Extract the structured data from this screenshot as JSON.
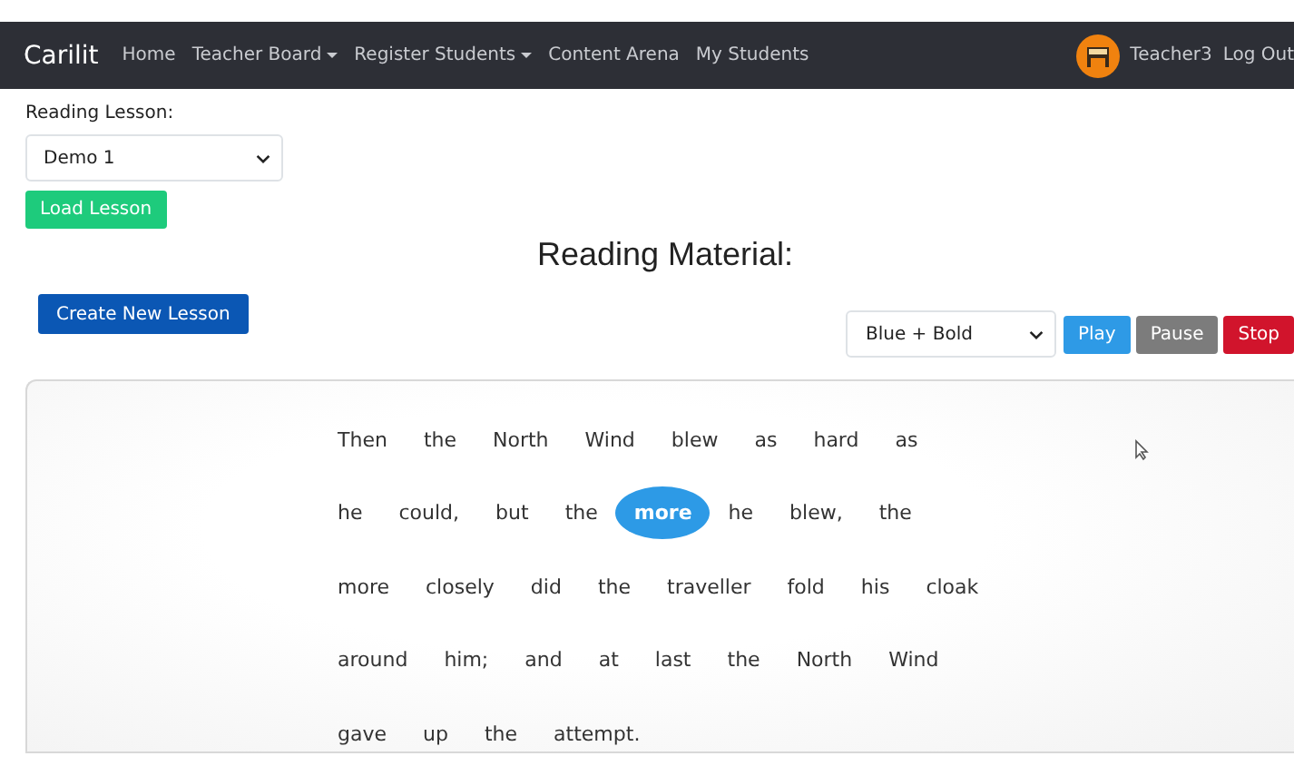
{
  "navbar": {
    "brand": "Carilit",
    "links": [
      {
        "label": "Home",
        "dropdown": false
      },
      {
        "label": "Teacher Board",
        "dropdown": true
      },
      {
        "label": "Register Students",
        "dropdown": true
      },
      {
        "label": "Content Arena",
        "dropdown": false
      },
      {
        "label": "My Students",
        "dropdown": false
      }
    ],
    "user": "Teacher3",
    "logout": "Log Out"
  },
  "lesson_label": "Reading Lesson:",
  "lesson_select": "Demo 1",
  "load_button": "Load Lesson",
  "heading": "Reading Material:",
  "create_button": "Create New Lesson",
  "style_select": "Blue + Bold",
  "playback_buttons": [
    {
      "label": "Play",
      "kind": "play"
    },
    {
      "label": "Pause",
      "kind": "pause"
    },
    {
      "label": "Stop",
      "kind": "stop"
    }
  ],
  "lines": [
    [
      {
        "text": "Then",
        "highlighted": false
      },
      {
        "text": "the",
        "highlighted": false
      },
      {
        "text": "North",
        "highlighted": false
      },
      {
        "text": "Wind",
        "highlighted": false
      },
      {
        "text": "blew",
        "highlighted": false
      },
      {
        "text": "as",
        "highlighted": false
      },
      {
        "text": "hard",
        "highlighted": false
      },
      {
        "text": "as",
        "highlighted": false
      }
    ],
    [
      {
        "text": "he",
        "highlighted": false
      },
      {
        "text": "could,",
        "highlighted": false
      },
      {
        "text": "but",
        "highlighted": false
      },
      {
        "text": "the",
        "highlighted": false
      },
      {
        "text": "more",
        "highlighted": true
      },
      {
        "text": "he",
        "highlighted": false
      },
      {
        "text": "blew,",
        "highlighted": false
      },
      {
        "text": "the",
        "highlighted": false
      }
    ],
    [
      {
        "text": "more",
        "highlighted": false
      },
      {
        "text": "closely",
        "highlighted": false
      },
      {
        "text": "did",
        "highlighted": false
      },
      {
        "text": "the",
        "highlighted": false
      },
      {
        "text": "traveller",
        "highlighted": false
      },
      {
        "text": "fold",
        "highlighted": false
      },
      {
        "text": "his",
        "highlighted": false
      },
      {
        "text": "cloak",
        "highlighted": false
      }
    ],
    [
      {
        "text": "around",
        "highlighted": false
      },
      {
        "text": "him;",
        "highlighted": false
      },
      {
        "text": "and",
        "highlighted": false
      },
      {
        "text": "at",
        "highlighted": false
      },
      {
        "text": "last",
        "highlighted": false
      },
      {
        "text": "the",
        "highlighted": false
      },
      {
        "text": "North",
        "highlighted": false
      },
      {
        "text": "Wind",
        "highlighted": false
      }
    ],
    [
      {
        "text": "gave",
        "highlighted": false
      },
      {
        "text": "up",
        "highlighted": false
      },
      {
        "text": "the",
        "highlighted": false
      },
      {
        "text": "attempt.",
        "highlighted": false
      }
    ]
  ]
}
